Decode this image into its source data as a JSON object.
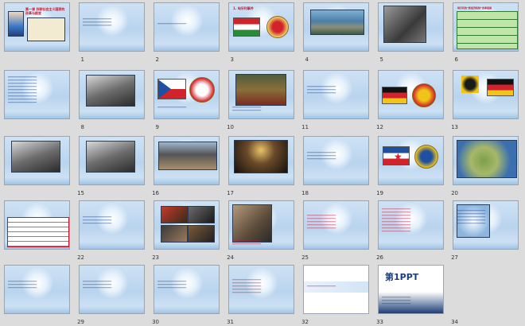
{
  "slides": [
    {
      "n": "1",
      "label": "第一课 苏联社会主义国家的改革与剧变",
      "kind": "title"
    },
    {
      "n": "2",
      "label": "",
      "kind": "text"
    },
    {
      "n": "3",
      "label": "",
      "kind": "blank"
    },
    {
      "n": "4",
      "label": "1. 匈牙利事件",
      "kind": "flags-hu"
    },
    {
      "n": "5",
      "label": "",
      "kind": "photo-city"
    },
    {
      "n": "6",
      "label": "",
      "kind": "photo-people"
    },
    {
      "n": "7",
      "label": "匈牙利的“新经济机制”改革措施",
      "kind": "table-green"
    },
    {
      "n": "8",
      "label": "",
      "kind": "text-dense"
    },
    {
      "n": "9",
      "label": "",
      "kind": "photo-bw"
    },
    {
      "n": "10",
      "label": "",
      "kind": "flags-cz"
    },
    {
      "n": "11",
      "label": "",
      "kind": "photo-crowd"
    },
    {
      "n": "12",
      "label": "",
      "kind": "text"
    },
    {
      "n": "13",
      "label": "",
      "kind": "flags-gdr"
    },
    {
      "n": "14",
      "label": "",
      "kind": "flags-de"
    },
    {
      "n": "15",
      "label": "",
      "kind": "photo-bw"
    },
    {
      "n": "16",
      "label": "",
      "kind": "photo-bw"
    },
    {
      "n": "17",
      "label": "",
      "kind": "photo-wall"
    },
    {
      "n": "18",
      "label": "",
      "kind": "photo-night"
    },
    {
      "n": "19",
      "label": "",
      "kind": "text"
    },
    {
      "n": "20",
      "label": "",
      "kind": "flags-yu"
    },
    {
      "n": "21",
      "label": "",
      "kind": "map"
    },
    {
      "n": "22",
      "label": "",
      "kind": "table-red"
    },
    {
      "n": "23",
      "label": "",
      "kind": "text"
    },
    {
      "n": "24",
      "label": "",
      "kind": "photo-collage"
    },
    {
      "n": "25",
      "label": "",
      "kind": "photo-crowd2"
    },
    {
      "n": "26",
      "label": "",
      "kind": "text-red"
    },
    {
      "n": "27",
      "label": "",
      "kind": "list-red"
    },
    {
      "n": "28",
      "label": "",
      "kind": "diagram"
    },
    {
      "n": "29",
      "label": "",
      "kind": "text"
    },
    {
      "n": "30",
      "label": "",
      "kind": "text"
    },
    {
      "n": "31",
      "label": "",
      "kind": "text"
    },
    {
      "n": "32",
      "label": "",
      "kind": "text-red"
    },
    {
      "n": "33",
      "label": "",
      "kind": "ad"
    },
    {
      "n": "34",
      "label": "第1PPT",
      "kind": "brand"
    }
  ],
  "colors": {
    "slide_bg": "#c6dcf2",
    "text_blue": "#1c3f7a",
    "text_red": "#c0152f"
  }
}
